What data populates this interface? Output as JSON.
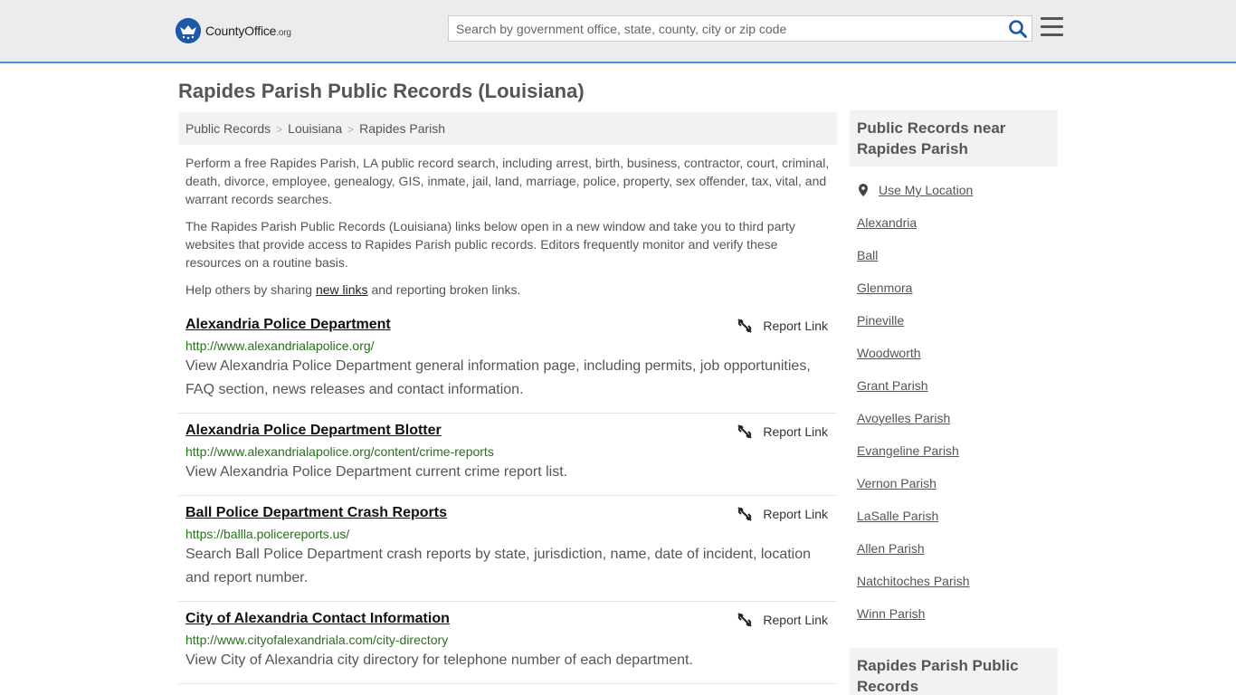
{
  "header": {
    "logo_main": "CountyOffice",
    "logo_tld": ".org",
    "search_placeholder": "Search by government office, state, county, city or zip code"
  },
  "page_title": "Rapides Parish Public Records (Louisiana)",
  "breadcrumb": [
    "Public Records",
    "Louisiana",
    "Rapides Parish"
  ],
  "intro": {
    "p1": "Perform a free Rapides Parish, LA public record search, including arrest, birth, business, contractor, court, criminal, death, divorce, employee, genealogy, GIS, inmate, jail, land, marriage, police, property, sex offender, tax, vital, and warrant records searches.",
    "p2": "The Rapides Parish Public Records (Louisiana) links below open in a new window and take you to third party websites that provide access to Rapides Parish public records. Editors frequently monitor and verify these resources on a routine basis.",
    "p3_before": "Help others by sharing ",
    "p3_link": "new links",
    "p3_after": " and reporting broken links."
  },
  "report_label": "Report Link",
  "listings": [
    {
      "title": "Alexandria Police Department",
      "url": "http://www.alexandrialapolice.org/",
      "desc": "View Alexandria Police Department general information page, including permits, job opportunities, FAQ section, news releases and contact information."
    },
    {
      "title": "Alexandria Police Department Blotter",
      "url": "http://www.alexandrialapolice.org/content/crime-reports",
      "desc": "View Alexandria Police Department current crime report list."
    },
    {
      "title": "Ball Police Department Crash Reports",
      "url": "https://ballla.policereports.us/",
      "desc": "Search Ball Police Department crash reports by state, jurisdiction, name, date of incident, location and report number."
    },
    {
      "title": "City of Alexandria Contact Information",
      "url": "http://www.cityofalexandriala.com/city-directory",
      "desc": "View City of Alexandria city directory for telephone number of each department."
    }
  ],
  "sidebar": {
    "heading": "Public Records near Rapides Parish",
    "use_location": "Use My Location",
    "links": [
      "Alexandria",
      "Ball",
      "Glenmora",
      "Pineville",
      "Woodworth",
      "Grant Parish",
      "Avoyelles Parish",
      "Evangeline Parish",
      "Vernon Parish",
      "LaSalle Parish",
      "Allen Parish",
      "Natchitoches Parish",
      "Winn Parish"
    ],
    "heading2": "Rapides Parish Public Records"
  }
}
